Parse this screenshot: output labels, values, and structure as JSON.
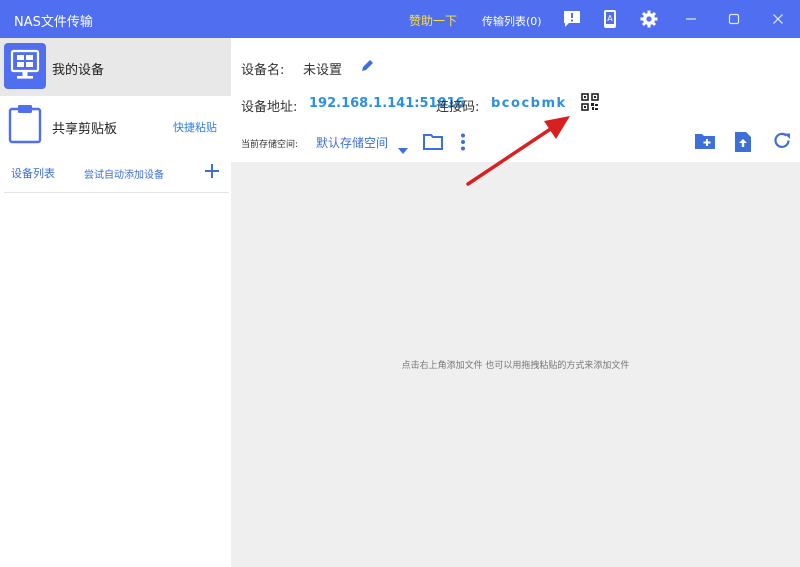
{
  "app": {
    "title": "NAS文件传输"
  },
  "titlebar": {
    "sponsor_label": "赞助一下",
    "transfer_list_label": "传输列表(0)",
    "icons": [
      "feedback-icon",
      "mobile-icon",
      "settings-icon",
      "minimize-icon",
      "maximize-icon",
      "close-icon"
    ]
  },
  "sidebar": {
    "device_label": "我的设备",
    "clipboard_label": "共享剪贴板",
    "quick_paste_label": "快捷粘贴",
    "device_list_label": "设备列表",
    "auto_add_label": "尝试自动添加设备"
  },
  "main": {
    "device_name_label": "设备名:",
    "device_name_value": "未设置",
    "address_label": "设备地址:",
    "address_value": "192.168.1.141:51016",
    "code_label": "连接码:",
    "code_value": "bcocbmk",
    "storage_label": "当前存储空间:",
    "storage_value": "默认存储空间",
    "empty_hint": "点击右上角添加文件 也可以用拖拽粘贴的方式来添加文件"
  },
  "colors": {
    "accent": "#4f6ff0",
    "sponsor": "#ffe135",
    "link": "#2d8fe0",
    "annotation_arrow": "#d92020"
  }
}
